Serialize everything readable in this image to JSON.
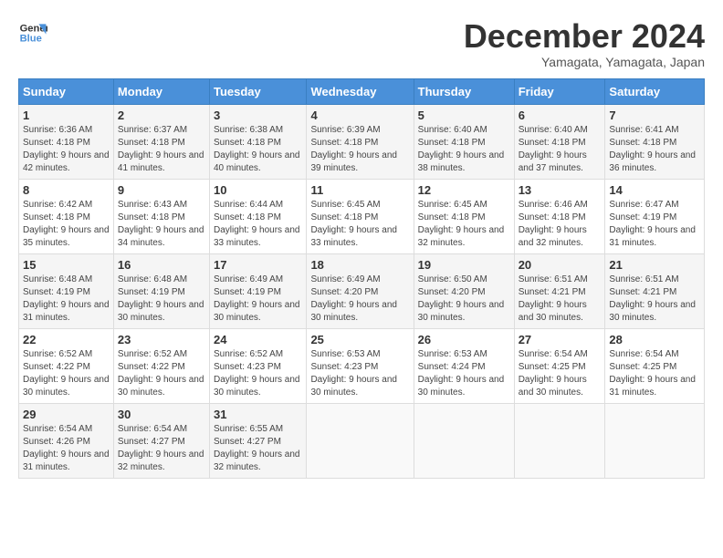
{
  "logo": {
    "line1": "General",
    "line2": "Blue"
  },
  "title": "December 2024",
  "subtitle": "Yamagata, Yamagata, Japan",
  "days_of_week": [
    "Sunday",
    "Monday",
    "Tuesday",
    "Wednesday",
    "Thursday",
    "Friday",
    "Saturday"
  ],
  "weeks": [
    [
      {
        "day": 1,
        "sunrise": "6:36 AM",
        "sunset": "4:18 PM",
        "daylight": "9 hours and 42 minutes."
      },
      {
        "day": 2,
        "sunrise": "6:37 AM",
        "sunset": "4:18 PM",
        "daylight": "9 hours and 41 minutes."
      },
      {
        "day": 3,
        "sunrise": "6:38 AM",
        "sunset": "4:18 PM",
        "daylight": "9 hours and 40 minutes."
      },
      {
        "day": 4,
        "sunrise": "6:39 AM",
        "sunset": "4:18 PM",
        "daylight": "9 hours and 39 minutes."
      },
      {
        "day": 5,
        "sunrise": "6:40 AM",
        "sunset": "4:18 PM",
        "daylight": "9 hours and 38 minutes."
      },
      {
        "day": 6,
        "sunrise": "6:40 AM",
        "sunset": "4:18 PM",
        "daylight": "9 hours and 37 minutes."
      },
      {
        "day": 7,
        "sunrise": "6:41 AM",
        "sunset": "4:18 PM",
        "daylight": "9 hours and 36 minutes."
      }
    ],
    [
      {
        "day": 8,
        "sunrise": "6:42 AM",
        "sunset": "4:18 PM",
        "daylight": "9 hours and 35 minutes."
      },
      {
        "day": 9,
        "sunrise": "6:43 AM",
        "sunset": "4:18 PM",
        "daylight": "9 hours and 34 minutes."
      },
      {
        "day": 10,
        "sunrise": "6:44 AM",
        "sunset": "4:18 PM",
        "daylight": "9 hours and 33 minutes."
      },
      {
        "day": 11,
        "sunrise": "6:45 AM",
        "sunset": "4:18 PM",
        "daylight": "9 hours and 33 minutes."
      },
      {
        "day": 12,
        "sunrise": "6:45 AM",
        "sunset": "4:18 PM",
        "daylight": "9 hours and 32 minutes."
      },
      {
        "day": 13,
        "sunrise": "6:46 AM",
        "sunset": "4:18 PM",
        "daylight": "9 hours and 32 minutes."
      },
      {
        "day": 14,
        "sunrise": "6:47 AM",
        "sunset": "4:19 PM",
        "daylight": "9 hours and 31 minutes."
      }
    ],
    [
      {
        "day": 15,
        "sunrise": "6:48 AM",
        "sunset": "4:19 PM",
        "daylight": "9 hours and 31 minutes."
      },
      {
        "day": 16,
        "sunrise": "6:48 AM",
        "sunset": "4:19 PM",
        "daylight": "9 hours and 30 minutes."
      },
      {
        "day": 17,
        "sunrise": "6:49 AM",
        "sunset": "4:19 PM",
        "daylight": "9 hours and 30 minutes."
      },
      {
        "day": 18,
        "sunrise": "6:49 AM",
        "sunset": "4:20 PM",
        "daylight": "9 hours and 30 minutes."
      },
      {
        "day": 19,
        "sunrise": "6:50 AM",
        "sunset": "4:20 PM",
        "daylight": "9 hours and 30 minutes."
      },
      {
        "day": 20,
        "sunrise": "6:51 AM",
        "sunset": "4:21 PM",
        "daylight": "9 hours and 30 minutes."
      },
      {
        "day": 21,
        "sunrise": "6:51 AM",
        "sunset": "4:21 PM",
        "daylight": "9 hours and 30 minutes."
      }
    ],
    [
      {
        "day": 22,
        "sunrise": "6:52 AM",
        "sunset": "4:22 PM",
        "daylight": "9 hours and 30 minutes."
      },
      {
        "day": 23,
        "sunrise": "6:52 AM",
        "sunset": "4:22 PM",
        "daylight": "9 hours and 30 minutes."
      },
      {
        "day": 24,
        "sunrise": "6:52 AM",
        "sunset": "4:23 PM",
        "daylight": "9 hours and 30 minutes."
      },
      {
        "day": 25,
        "sunrise": "6:53 AM",
        "sunset": "4:23 PM",
        "daylight": "9 hours and 30 minutes."
      },
      {
        "day": 26,
        "sunrise": "6:53 AM",
        "sunset": "4:24 PM",
        "daylight": "9 hours and 30 minutes."
      },
      {
        "day": 27,
        "sunrise": "6:54 AM",
        "sunset": "4:25 PM",
        "daylight": "9 hours and 30 minutes."
      },
      {
        "day": 28,
        "sunrise": "6:54 AM",
        "sunset": "4:25 PM",
        "daylight": "9 hours and 31 minutes."
      }
    ],
    [
      {
        "day": 29,
        "sunrise": "6:54 AM",
        "sunset": "4:26 PM",
        "daylight": "9 hours and 31 minutes."
      },
      {
        "day": 30,
        "sunrise": "6:54 AM",
        "sunset": "4:27 PM",
        "daylight": "9 hours and 32 minutes."
      },
      {
        "day": 31,
        "sunrise": "6:55 AM",
        "sunset": "4:27 PM",
        "daylight": "9 hours and 32 minutes."
      },
      null,
      null,
      null,
      null
    ]
  ]
}
